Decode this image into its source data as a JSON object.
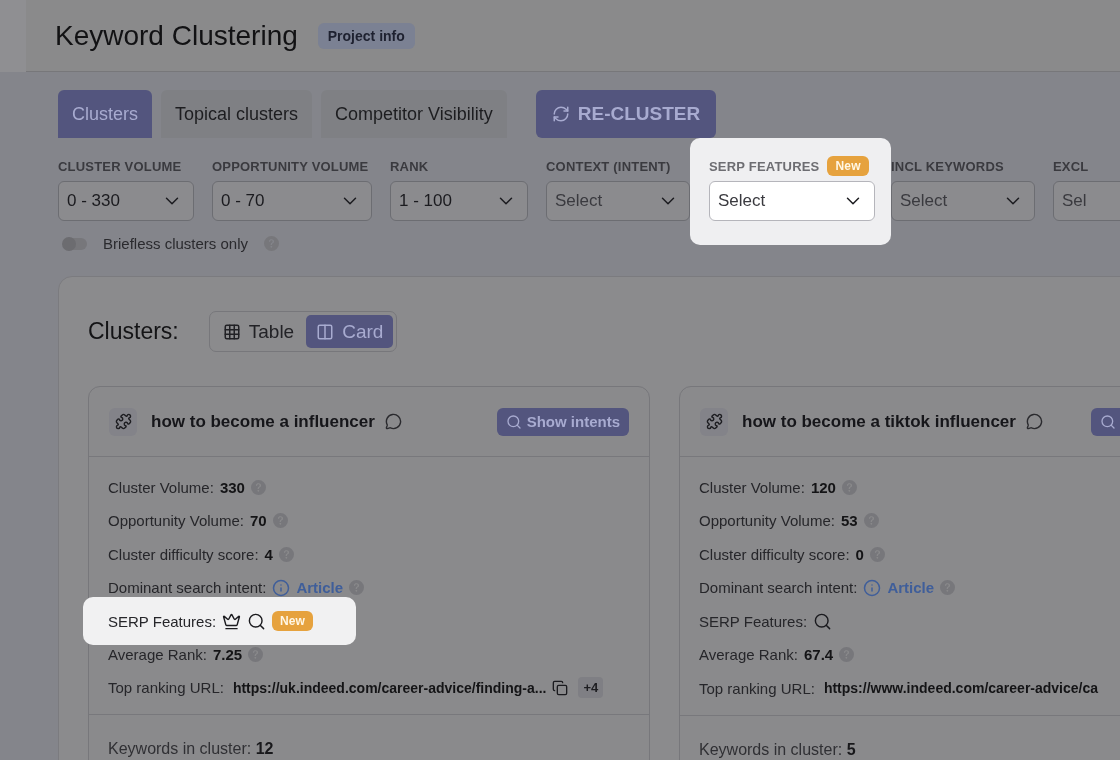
{
  "header": {
    "title": "Keyword Clustering",
    "badge": "Project info"
  },
  "tabs": [
    {
      "label": "Clusters",
      "selected": true
    },
    {
      "label": "Topical clusters",
      "selected": false
    },
    {
      "label": "Competitor Visibility",
      "selected": false
    }
  ],
  "action_button": {
    "label": "RE-CLUSTER"
  },
  "filters": [
    {
      "label": "CLUSTER VOLUME",
      "value": "0 - 330",
      "highlighted": false
    },
    {
      "label": "OPPORTUNITY VOLUME",
      "value": "0 - 70",
      "highlighted": false
    },
    {
      "label": "RANK",
      "value": "1 - 100",
      "highlighted": false
    },
    {
      "label": "CONTEXT (INTENT)",
      "placeholder": "Select",
      "highlighted": false
    },
    {
      "label": "SERP FEATURES",
      "badge": "New",
      "placeholder": "Select",
      "highlighted": true
    },
    {
      "label": "INCL KEYWORDS",
      "placeholder": "Select",
      "highlighted": false
    },
    {
      "label": "EXCL",
      "placeholder": "Sel",
      "highlighted": false
    }
  ],
  "toggle": {
    "label": "Briefless clusters only",
    "on": false
  },
  "panel": {
    "title": "Clusters:",
    "views": [
      {
        "kind": "table",
        "label": "Table",
        "selected": false
      },
      {
        "kind": "card",
        "label": "Card",
        "selected": true
      }
    ]
  },
  "cards": [
    {
      "title": "how to become a influencer",
      "action_label": "Show intents",
      "stats": [
        {
          "kind": "metric",
          "label": "Cluster Volume:",
          "value": "330"
        },
        {
          "kind": "metric",
          "label": "Opportunity Volume:",
          "value": "70"
        },
        {
          "kind": "metric",
          "label": "Cluster difficulty score:",
          "value": "4"
        },
        {
          "kind": "intent",
          "label": "Dominant search intent:",
          "value": "Article"
        },
        {
          "kind": "serp",
          "label": "SERP Features:",
          "features": [
            {
              "kind": "crown"
            },
            {
              "kind": "search"
            }
          ],
          "badge": "New",
          "highlighted": true
        },
        {
          "kind": "metric",
          "label": "Average Rank:",
          "value": "7.25"
        },
        {
          "kind": "url",
          "label": "Top ranking URL:",
          "value": "https://uk.indeed.com/career-advice/finding-a...",
          "extra": "+4"
        }
      ],
      "keywords_label": "Keywords in cluster:",
      "keywords_value": "12"
    },
    {
      "title": "how to become a tiktok influencer",
      "stats": [
        {
          "kind": "metric",
          "label": "Cluster Volume:",
          "value": "120"
        },
        {
          "kind": "metric",
          "label": "Opportunity Volume:",
          "value": "53"
        },
        {
          "kind": "metric",
          "label": "Cluster difficulty score:",
          "value": "0"
        },
        {
          "kind": "intent",
          "label": "Dominant search intent:",
          "value": "Article"
        },
        {
          "kind": "serp",
          "label": "SERP Features:",
          "features": [
            {
              "kind": "search"
            }
          ],
          "highlighted": false
        },
        {
          "kind": "metric",
          "label": "Average Rank:",
          "value": "67.4"
        },
        {
          "kind": "url",
          "label": "Top ranking URL:",
          "value": "https://www.indeed.com/career-advice/ca"
        }
      ],
      "keywords_label": "Keywords in cluster:",
      "keywords_value": "5"
    }
  ]
}
